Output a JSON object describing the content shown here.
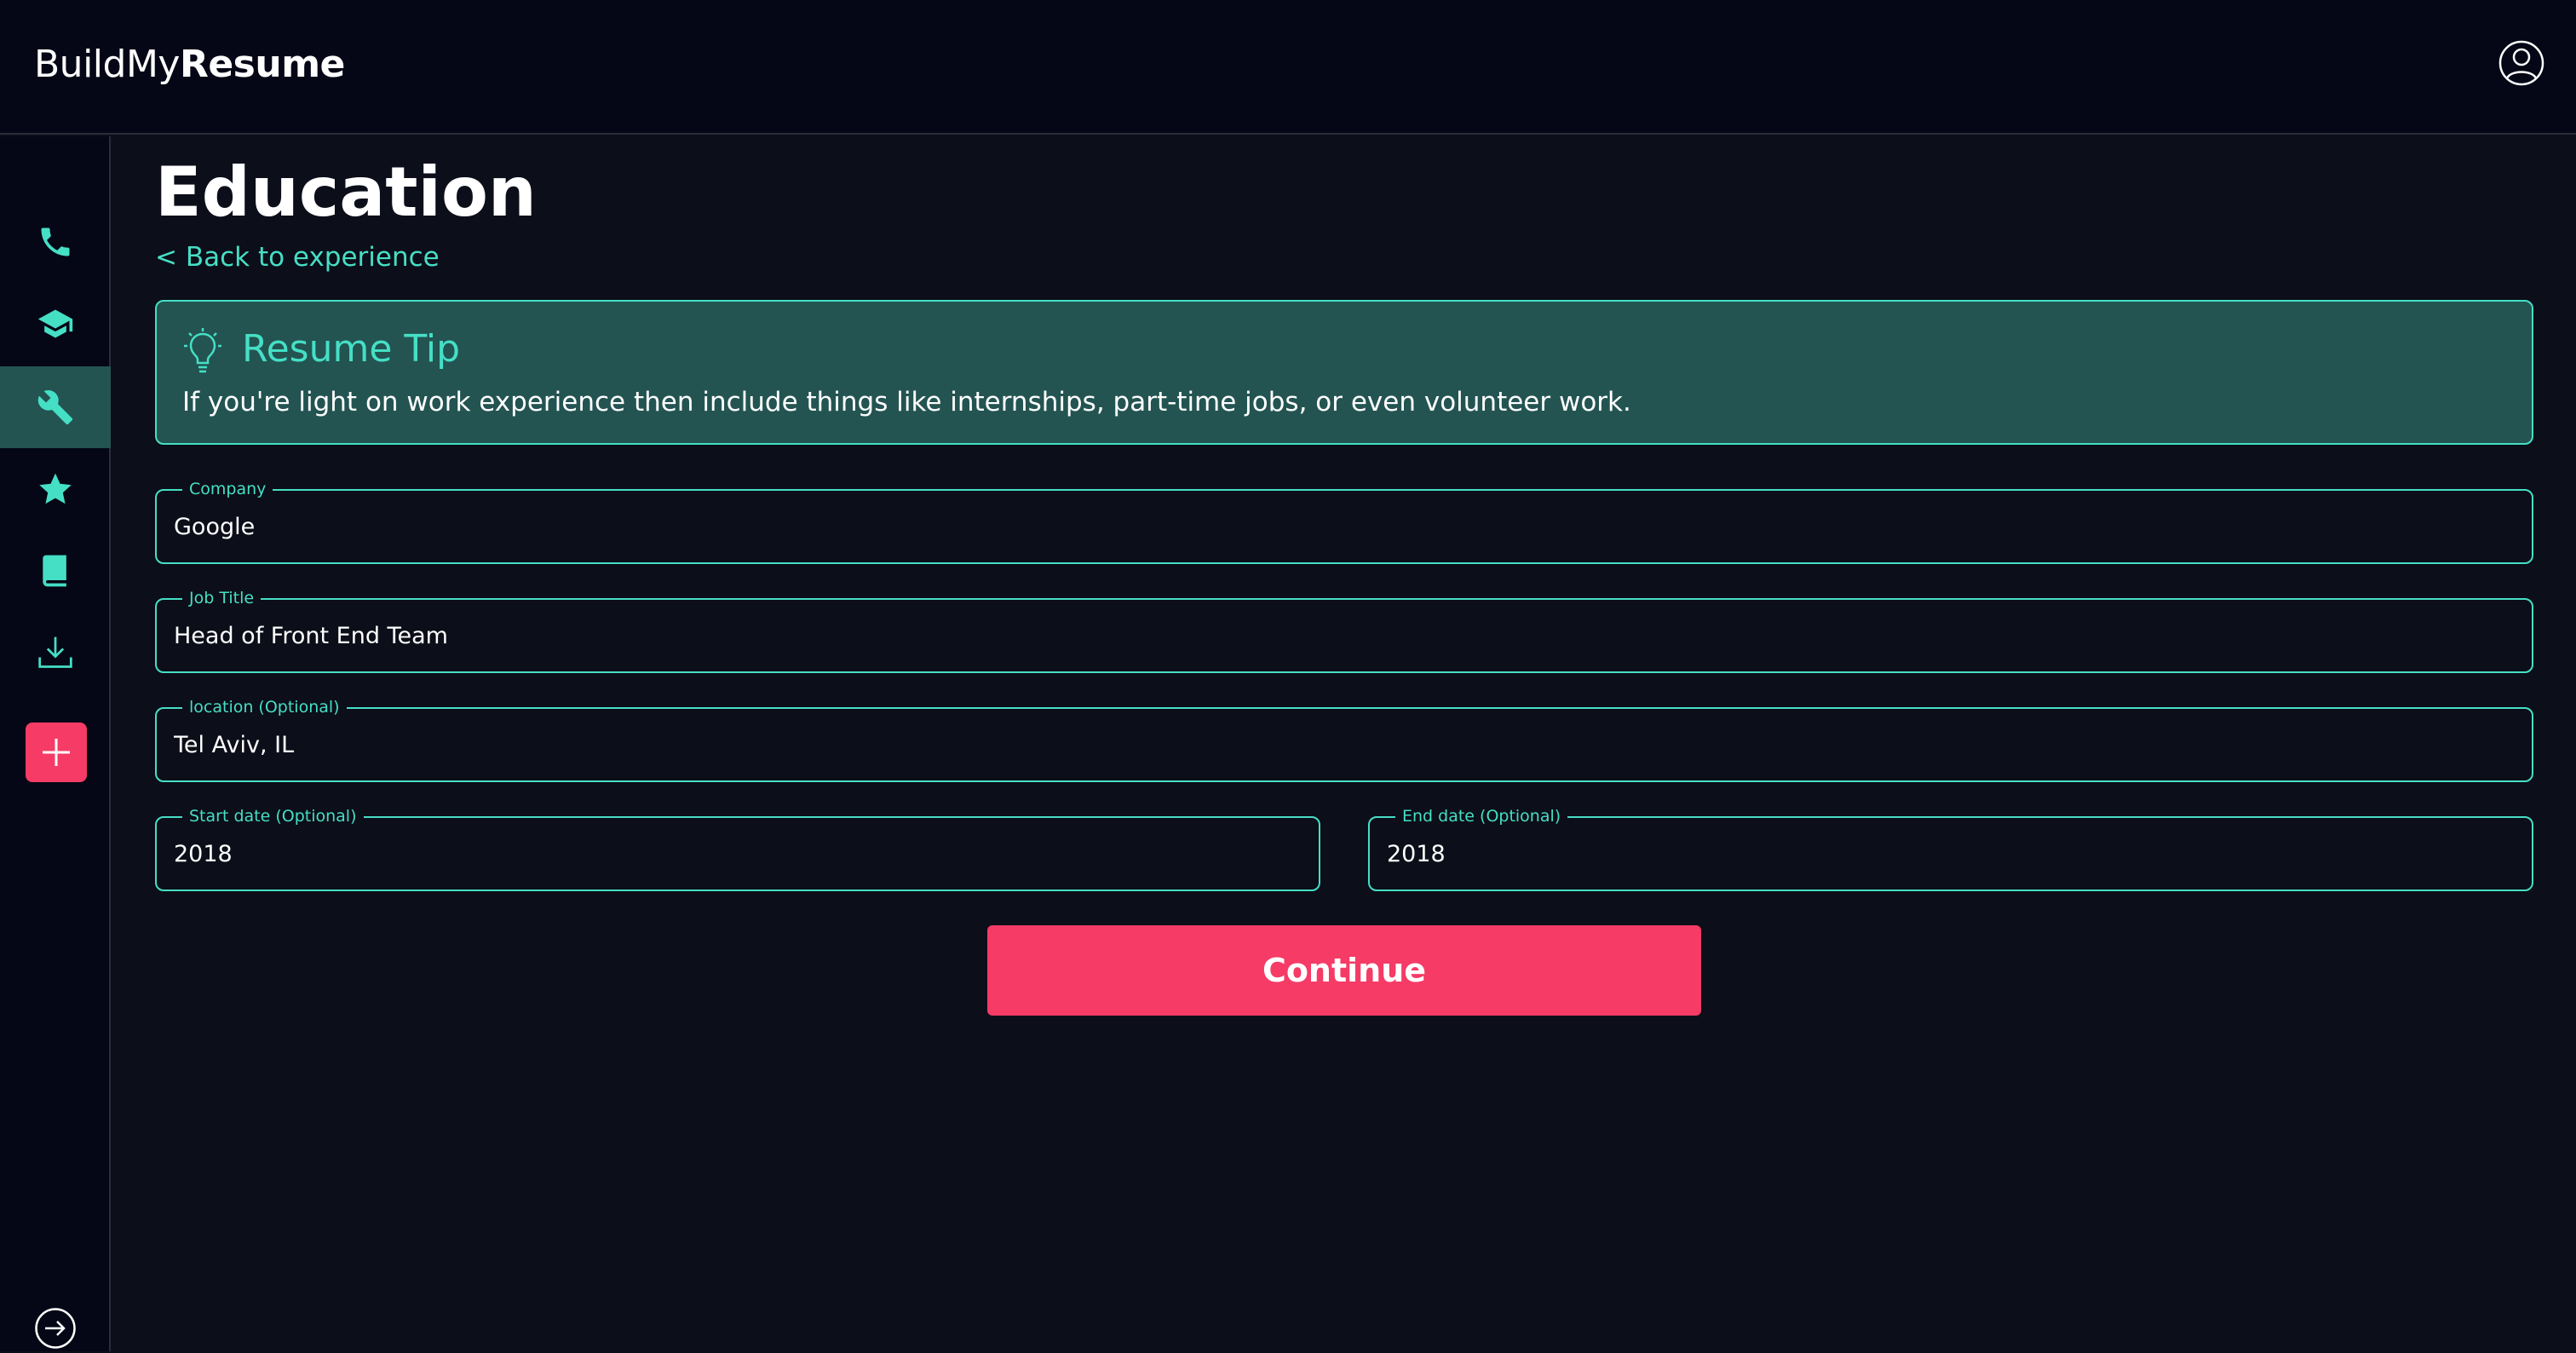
{
  "app": {
    "logo_light": "BuildMy",
    "logo_bold": "Resume"
  },
  "colors": {
    "accent": "#45dfc5",
    "primary_button": "#f53b66",
    "tip_background": "#235452",
    "header_background": "#050716",
    "page_background": "#0c0e19"
  },
  "header": {
    "account_icon": "user-circle-icon"
  },
  "sidebar": {
    "items": [
      {
        "icon": "phone-icon",
        "active": false
      },
      {
        "icon": "graduation-cap-icon",
        "active": false
      },
      {
        "icon": "wrench-icon",
        "active": true
      },
      {
        "icon": "star-icon",
        "active": false
      },
      {
        "icon": "book-icon",
        "active": false
      },
      {
        "icon": "download-icon",
        "active": false
      }
    ],
    "add_icon": "plus-icon",
    "logout_icon": "arrow-right-circle-icon"
  },
  "main": {
    "title": "Education",
    "back_link": "< Back to experience",
    "tip": {
      "icon": "lightbulb-icon",
      "title": "Resume Tip",
      "text": "If you're light on work experience then include things like internships, part-time jobs, or even volunteer work."
    },
    "form": {
      "company": {
        "label": "Company",
        "value": "Google"
      },
      "job_title": {
        "label": "Job Title",
        "value": "Head of Front End Team"
      },
      "location": {
        "label": "location (Optional)",
        "value": "Tel Aviv, IL"
      },
      "start_date": {
        "label": "Start date (Optional)",
        "value": "2018"
      },
      "end_date": {
        "label": "End date (Optional)",
        "value": "2018"
      }
    },
    "continue_label": "Continue"
  }
}
